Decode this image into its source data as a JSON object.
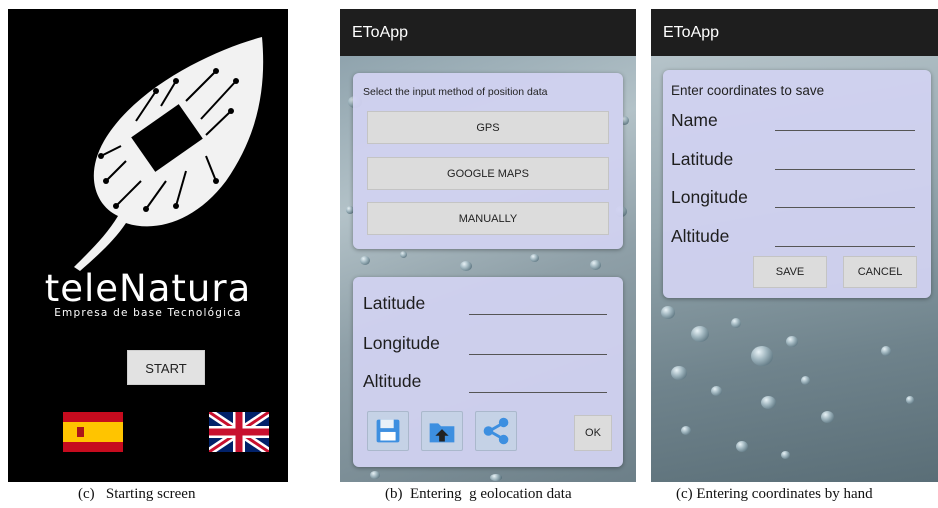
{
  "screen_a": {
    "brand_name": "teleNatura",
    "brand_sub": "Empresa de base Tecnológica",
    "start_label": "START",
    "caption": "(c)   Starting screen"
  },
  "screen_b": {
    "app_title": "EToApp",
    "select_hint": "Select the input method of position data",
    "options": [
      "GPS",
      "GOOGLE MAPS",
      "MANUALLY"
    ],
    "fields": [
      "Latitude",
      "Longitude",
      "Altitude"
    ],
    "ok_label": "OK",
    "icons": [
      "save-icon",
      "folder-icon",
      "share-icon"
    ],
    "caption": "(b)  Entering  g eolocation data"
  },
  "screen_c": {
    "app_title": "EToApp",
    "prompt": "Enter coordinates to save",
    "fields": [
      "Name",
      "Latitude",
      "Longitude",
      "Altitude"
    ],
    "save_label": "SAVE",
    "cancel_label": "CANCEL",
    "caption": "(c) Entering coordinates by hand"
  }
}
